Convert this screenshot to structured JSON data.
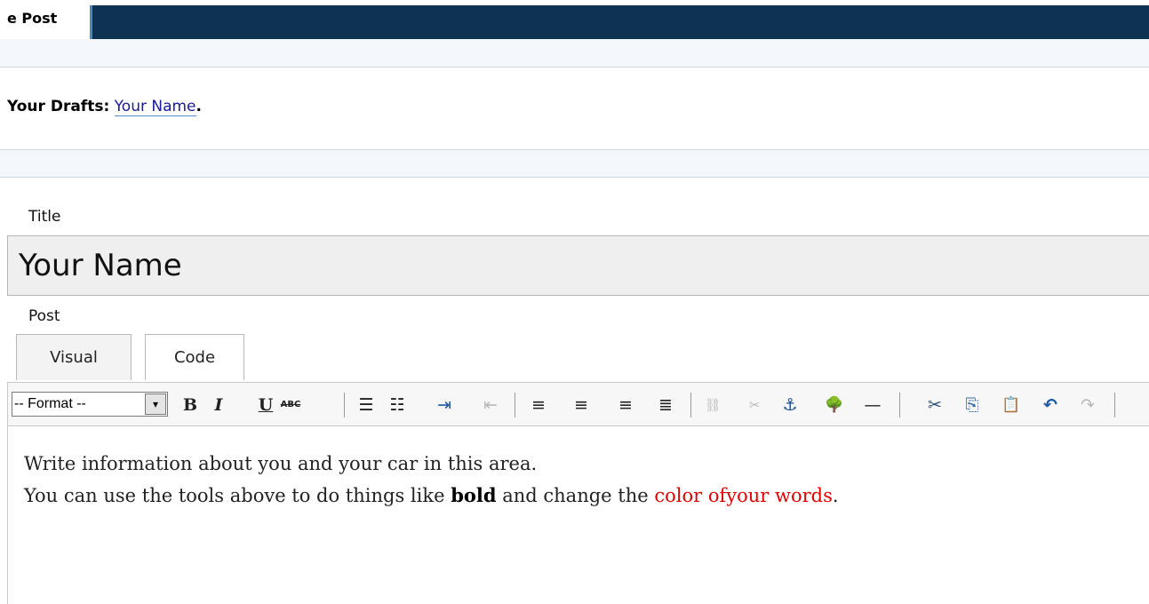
{
  "header": {
    "tab_label": "e Post"
  },
  "drafts": {
    "label": "Your Drafts",
    "colon": ":",
    "link": "Your Name",
    "end": "."
  },
  "form": {
    "title_label": "Title",
    "title_value": "Your Name",
    "post_label": "Post"
  },
  "editor_tabs": {
    "visual": "Visual",
    "code": "Code"
  },
  "toolbar": {
    "format_value": "-- Format --",
    "format_arrow": "▾",
    "bold": "B",
    "italic": "I",
    "underline": "U",
    "strike": "ABC",
    "buttons": [
      "☰",
      "☷",
      "⇥",
      "⇤",
      "≡",
      "≡",
      "≡",
      "≣",
      "⛓",
      "✂",
      "⚓",
      "🌳",
      "—",
      "✂",
      "⎘",
      "📋",
      "↶",
      "↷"
    ]
  },
  "content": {
    "line1": "Write information about you and your car in this area.",
    "line2_pre": "You can use the tools above to do things like ",
    "line2_bold": "bold",
    "line2_mid": " and change the ",
    "line2_red": "color ofyour words",
    "line2_end": "."
  },
  "colors": {
    "header_bg": "#0e3352",
    "accent_red": "#e00000",
    "link": "#1a1a9a"
  }
}
